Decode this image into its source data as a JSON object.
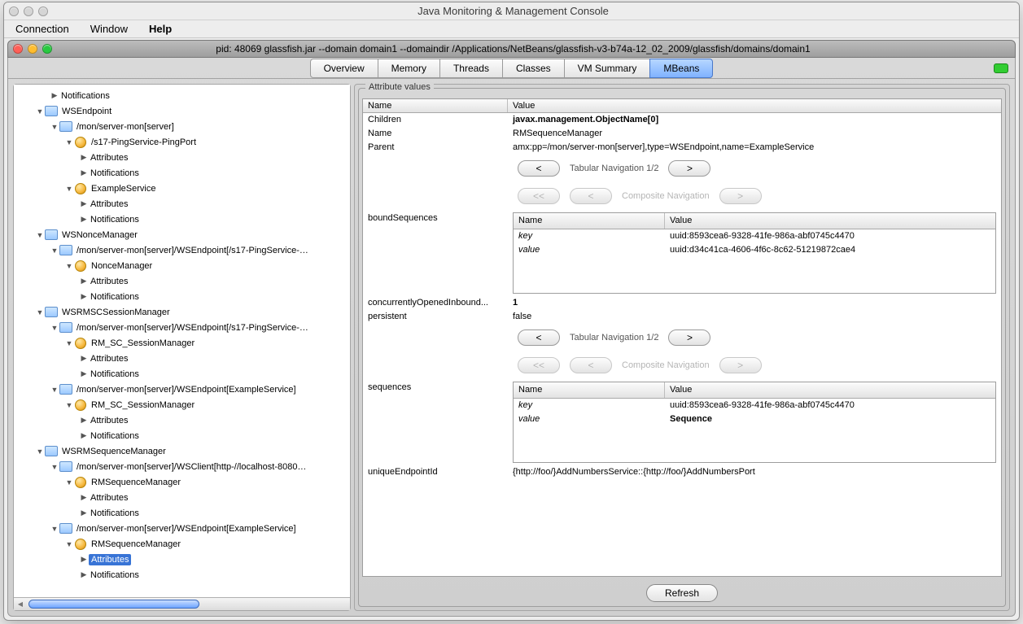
{
  "app": {
    "title": "Java Monitoring & Management Console"
  },
  "menu": {
    "items": [
      "Connection",
      "Window",
      "Help"
    ]
  },
  "doc": {
    "title": "pid: 48069 glassfish.jar --domain domain1 --domaindir /Applications/NetBeans/glassfish-v3-b74a-12_02_2009/glassfish/domains/domain1"
  },
  "tabs": {
    "items": [
      "Overview",
      "Memory",
      "Threads",
      "Classes",
      "VM Summary",
      "MBeans"
    ],
    "activeIndex": 5
  },
  "tree": {
    "rows": [
      {
        "indent": 2,
        "disclosure": "▶",
        "icon": "",
        "label": "Notifications"
      },
      {
        "indent": 1,
        "disclosure": "▼",
        "icon": "folder",
        "label": "WSEndpoint"
      },
      {
        "indent": 2,
        "disclosure": "▼",
        "icon": "folder",
        "label": "/mon/server-mon[server]"
      },
      {
        "indent": 3,
        "disclosure": "▼",
        "icon": "bean",
        "label": "/s17-PingService-PingPort"
      },
      {
        "indent": 4,
        "disclosure": "▶",
        "icon": "",
        "label": "Attributes"
      },
      {
        "indent": 4,
        "disclosure": "▶",
        "icon": "",
        "label": "Notifications"
      },
      {
        "indent": 3,
        "disclosure": "▼",
        "icon": "bean",
        "label": "ExampleService"
      },
      {
        "indent": 4,
        "disclosure": "▶",
        "icon": "",
        "label": "Attributes"
      },
      {
        "indent": 4,
        "disclosure": "▶",
        "icon": "",
        "label": "Notifications"
      },
      {
        "indent": 1,
        "disclosure": "▼",
        "icon": "folder",
        "label": "WSNonceManager"
      },
      {
        "indent": 2,
        "disclosure": "▼",
        "icon": "folder",
        "label": "/mon/server-mon[server]/WSEndpoint[/s17-PingService-…"
      },
      {
        "indent": 3,
        "disclosure": "▼",
        "icon": "bean",
        "label": "NonceManager"
      },
      {
        "indent": 4,
        "disclosure": "▶",
        "icon": "",
        "label": "Attributes"
      },
      {
        "indent": 4,
        "disclosure": "▶",
        "icon": "",
        "label": "Notifications"
      },
      {
        "indent": 1,
        "disclosure": "▼",
        "icon": "folder",
        "label": "WSRMSCSessionManager"
      },
      {
        "indent": 2,
        "disclosure": "▼",
        "icon": "folder",
        "label": "/mon/server-mon[server]/WSEndpoint[/s17-PingService-…"
      },
      {
        "indent": 3,
        "disclosure": "▼",
        "icon": "bean",
        "label": "RM_SC_SessionManager"
      },
      {
        "indent": 4,
        "disclosure": "▶",
        "icon": "",
        "label": "Attributes"
      },
      {
        "indent": 4,
        "disclosure": "▶",
        "icon": "",
        "label": "Notifications"
      },
      {
        "indent": 2,
        "disclosure": "▼",
        "icon": "folder",
        "label": "/mon/server-mon[server]/WSEndpoint[ExampleService]"
      },
      {
        "indent": 3,
        "disclosure": "▼",
        "icon": "bean",
        "label": "RM_SC_SessionManager"
      },
      {
        "indent": 4,
        "disclosure": "▶",
        "icon": "",
        "label": "Attributes"
      },
      {
        "indent": 4,
        "disclosure": "▶",
        "icon": "",
        "label": "Notifications"
      },
      {
        "indent": 1,
        "disclosure": "▼",
        "icon": "folder",
        "label": "WSRMSequenceManager"
      },
      {
        "indent": 2,
        "disclosure": "▼",
        "icon": "folder",
        "label": "/mon/server-mon[server]/WSClient[http-//localhost-8080…"
      },
      {
        "indent": 3,
        "disclosure": "▼",
        "icon": "bean",
        "label": "RMSequenceManager"
      },
      {
        "indent": 4,
        "disclosure": "▶",
        "icon": "",
        "label": "Attributes"
      },
      {
        "indent": 4,
        "disclosure": "▶",
        "icon": "",
        "label": "Notifications"
      },
      {
        "indent": 2,
        "disclosure": "▼",
        "icon": "folder",
        "label": "/mon/server-mon[server]/WSEndpoint[ExampleService]"
      },
      {
        "indent": 3,
        "disclosure": "▼",
        "icon": "bean",
        "label": "RMSequenceManager"
      },
      {
        "indent": 4,
        "disclosure": "▶",
        "icon": "",
        "label": "Attributes",
        "selected": true
      },
      {
        "indent": 4,
        "disclosure": "▶",
        "icon": "",
        "label": "Notifications"
      }
    ]
  },
  "attrs": {
    "groupTitle": "Attribute values",
    "thName": "Name",
    "thValue": "Value",
    "children": {
      "k": "Children",
      "v": "javax.management.ObjectName[0]",
      "bold": true
    },
    "name": {
      "k": "Name",
      "v": "RMSequenceManager"
    },
    "parent": {
      "k": "Parent",
      "v": "amx:pp=/mon/server-mon[server],type=WSEndpoint,name=ExampleService"
    },
    "tabNav1": {
      "prev": "<",
      "label": "Tabular Navigation 1/2",
      "next": ">"
    },
    "compNav1": {
      "first": "<<",
      "prev": "<",
      "label": "Composite Navigation",
      "next": ">"
    },
    "boundSeq": {
      "k": "boundSequences",
      "thName": "Name",
      "thValue": "Value",
      "rows": [
        {
          "k": "key",
          "v": "uuid:8593cea6-9328-41fe-986a-abf0745c4470"
        },
        {
          "k": "value",
          "v": "uuid:d34c41ca-4606-4f6c-8c62-51219872cae4"
        }
      ]
    },
    "concurrent": {
      "k": "concurrentlyOpenedInbound...",
      "v": "1",
      "bold": true
    },
    "persistent": {
      "k": "persistent",
      "v": "false"
    },
    "tabNav2": {
      "prev": "<",
      "label": "Tabular Navigation 1/2",
      "next": ">"
    },
    "compNav2": {
      "first": "<<",
      "prev": "<",
      "label": "Composite Navigation",
      "next": ">"
    },
    "sequences": {
      "k": "sequences",
      "thName": "Name",
      "thValue": "Value",
      "rows": [
        {
          "k": "key",
          "v": "uuid:8593cea6-9328-41fe-986a-abf0745c4470"
        },
        {
          "k": "value",
          "v": "Sequence",
          "bold": true
        }
      ]
    },
    "uniqueEP": {
      "k": "uniqueEndpointId",
      "v": "{http://foo/}AddNumbersService::{http://foo/}AddNumbersPort"
    },
    "refresh": "Refresh"
  }
}
